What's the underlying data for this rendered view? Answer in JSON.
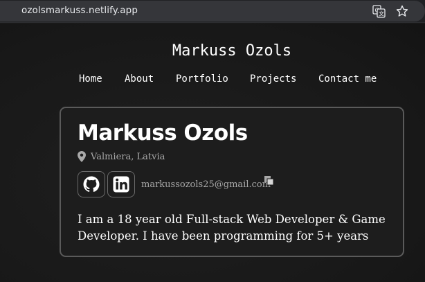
{
  "browser": {
    "url": "ozolsmarkuss.netlify.app",
    "icons": [
      "site-settings-icon",
      "translate-icon",
      "star-icon"
    ]
  },
  "header": {
    "title": "Markuss Ozols",
    "nav": [
      "Home",
      "About",
      "Portfolio",
      "Projects",
      "Contact me"
    ]
  },
  "profile": {
    "name": "Markuss Ozols",
    "location": "Valmiera, Latvia",
    "email": "markussozols25@gmail.com",
    "social": [
      "github-icon",
      "linkedin-icon"
    ],
    "bio": "I am a 18 year old Full-stack Web Developer & Game Developer. I have been programming for 5+ years"
  },
  "colors": {
    "background": "#1b1b1b",
    "card_border": "#5a5a5a",
    "muted_text": "#a9a9a9",
    "text": "#ffffff"
  }
}
